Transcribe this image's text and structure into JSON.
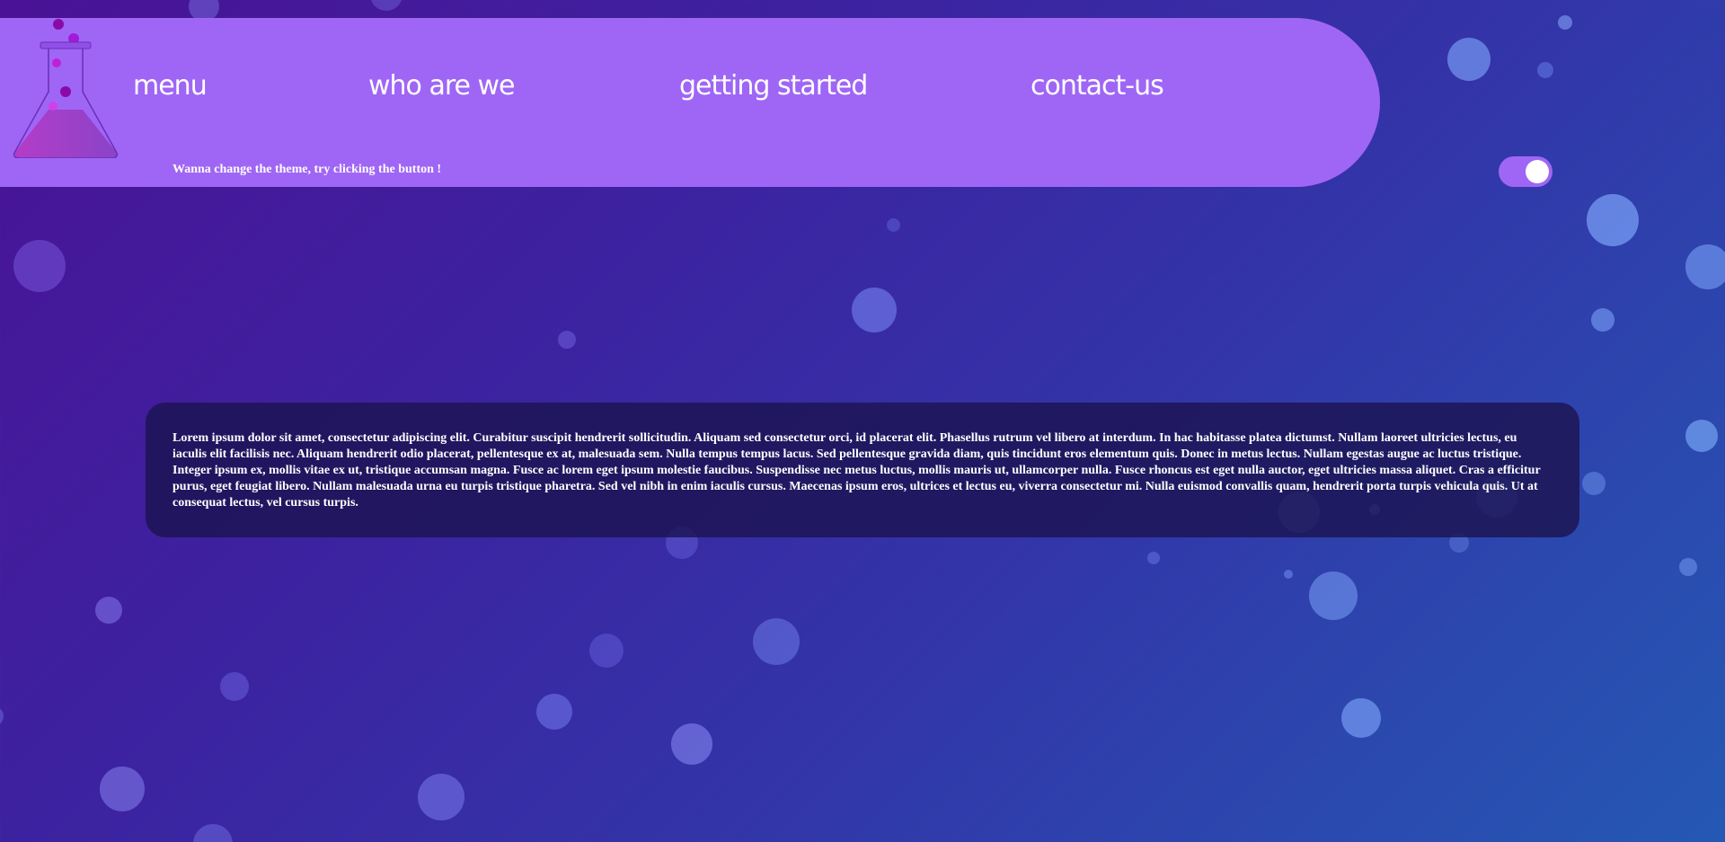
{
  "nav": {
    "links": [
      {
        "label": "menu"
      },
      {
        "label": "who are we"
      },
      {
        "label": "getting started"
      },
      {
        "label": "contact-us"
      }
    ]
  },
  "theme": {
    "hint": "Wanna change the theme, try clicking the button !",
    "toggle_on": true
  },
  "content": {
    "paragraph": "Lorem ipsum dolor sit amet, consectetur adipiscing elit. Curabitur suscipit hendrerit sollicitudin. Aliquam sed consectetur orci, id placerat elit. Phasellus rutrum vel libero at interdum. In hac habitasse platea dictumst. Nullam laoreet ultricies lectus, eu iaculis elit facilisis nec. Aliquam hendrerit odio placerat, pellentesque ex at, malesuada sem. Nulla tempus tempus lacus. Sed pellentesque gravida diam, quis tincidunt eros elementum quis. Donec in metus lectus. Nullam egestas augue ac luctus tristique. Integer ipsum ex, mollis vitae ex ut, tristique accumsan magna. Fusce ac lorem eget ipsum molestie faucibus. Suspendisse nec metus luctus, mollis mauris ut, ullamcorper nulla. Fusce rhoncus est eget nulla auctor, eget ultricies massa aliquet. Cras a efficitur purus, eget feugiat libero. Nullam malesuada urna eu turpis tristique pharetra. Sed vel nibh in enim iaculis cursus. Maecenas ipsum eros, ultrices et lectus eu, viverra consectetur mi. Nulla euismod convallis quam, hendrerit porta turpis vehicula quis. Ut at consequat lectus, vel cursus turpis."
  },
  "colors": {
    "nav_background": "#9f66f5",
    "card_background": "#1c1452",
    "bubble": "#7aa0ff",
    "flask_liquid": "#b43cc8"
  },
  "icons": {
    "logo": "flask-icon"
  }
}
